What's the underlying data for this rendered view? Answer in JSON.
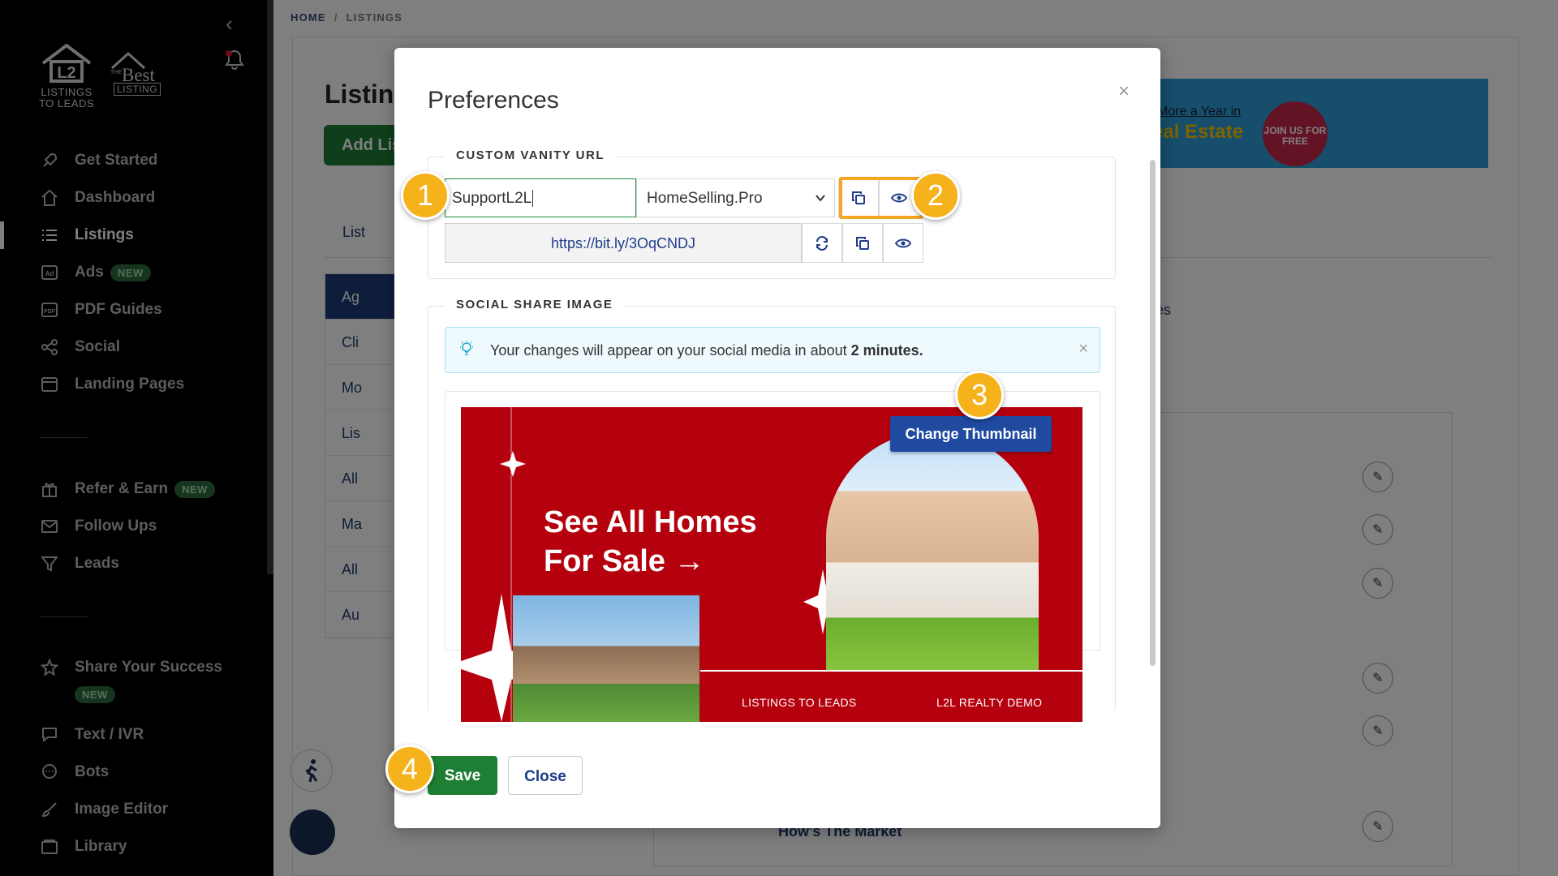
{
  "sidebar": {
    "logo1": {
      "line1": "LISTINGS",
      "line2": "TO LEADS"
    },
    "logo2": {
      "the": "THE",
      "best": "Best",
      "listing": "LISTING"
    },
    "items": [
      {
        "label": "Get Started",
        "icon": "rocket-icon"
      },
      {
        "label": "Dashboard",
        "icon": "home-icon"
      },
      {
        "label": "Listings",
        "icon": "list-icon",
        "active": true
      },
      {
        "label": "Ads",
        "icon": "ad-icon",
        "badge": "NEW"
      },
      {
        "label": "PDF Guides",
        "icon": "pdf-icon"
      },
      {
        "label": "Social",
        "icon": "share-icon"
      },
      {
        "label": "Landing Pages",
        "icon": "window-icon"
      },
      {
        "label": "Refer & Earn",
        "icon": "gift-icon",
        "badge": "NEW"
      },
      {
        "label": "Follow Ups",
        "icon": "envelope-icon"
      },
      {
        "label": "Leads",
        "icon": "filter-icon"
      },
      {
        "label": "Share Your Success",
        "icon": "star-icon",
        "badge": "NEW"
      },
      {
        "label": "Text / IVR",
        "icon": "message-icon"
      },
      {
        "label": "Bots",
        "icon": "chat-icon"
      },
      {
        "label": "Image Editor",
        "icon": "brush-icon"
      },
      {
        "label": "Library",
        "icon": "folder-icon"
      }
    ]
  },
  "breadcrumb": {
    "home": "HOME",
    "current": "LISTINGS",
    "separator": "/"
  },
  "background": {
    "page_title": "Listing",
    "add_button": "Add Lis",
    "tab_label": "List",
    "banner_line1": "More a Year in",
    "banner_line2": "eal Estate",
    "banner_join": "JOIN US FOR FREE",
    "left_list": [
      "Ag",
      "Cli",
      "Mo",
      "Lis",
      "All",
      "Ma",
      "All",
      "Au"
    ],
    "row_text": "How's The Market",
    "tab_fragment": "es"
  },
  "modal": {
    "title": "Preferences",
    "close_symbol": "×",
    "vanity": {
      "legend": "CUSTOM VANITY URL",
      "slug_value": "SupportL2L",
      "domain_value": "HomeSelling.Pro",
      "short_url": "https://bit.ly/3OqCNDJ"
    },
    "social": {
      "legend": "SOCIAL SHARE IMAGE",
      "alert_text": "Your changes will appear on your social media in about ",
      "alert_bold": "2 minutes.",
      "alert_close": "×",
      "change_thumbnail": "Change Thumbnail",
      "thumb_headline_1": "See All Homes",
      "thumb_headline_2": "For Sale →",
      "thumb_footer_left": "LISTINGS TO LEADS",
      "thumb_footer_right": "L2L REALTY DEMO"
    },
    "save_label": "Save",
    "close_label": "Close"
  },
  "steps": [
    "1",
    "2",
    "3",
    "4"
  ],
  "colors": {
    "primary_green": "#1e7e34",
    "brand_blue": "#1f4aa0",
    "highlight": "#f5a623",
    "thumb_red": "#b5000e"
  }
}
